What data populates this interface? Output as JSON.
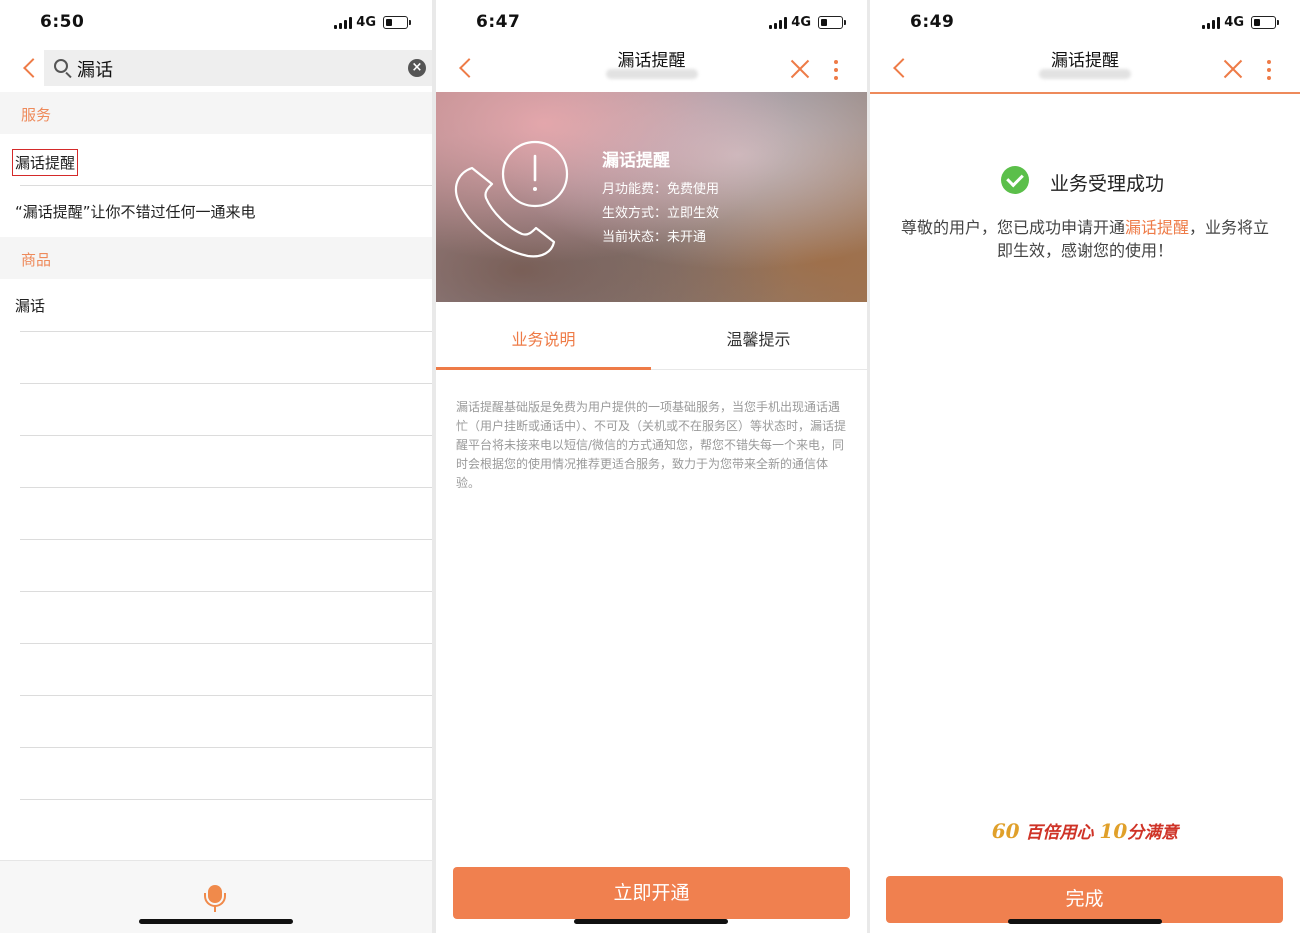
{
  "panel1": {
    "status": {
      "time": "6:50",
      "network": "4G"
    },
    "search": {
      "query": "漏话"
    },
    "sections": [
      {
        "title": "服务",
        "items": [
          "漏话提醒",
          "“漏话提醒”让你不错过任何一通来电"
        ]
      },
      {
        "title": "商品",
        "items": [
          "漏话"
        ]
      }
    ]
  },
  "panel2": {
    "status": {
      "time": "6:47",
      "network": "4G"
    },
    "header": {
      "title": "漏话提醒"
    },
    "banner": {
      "title": "漏话提醒",
      "lines": [
        "月功能费：免费使用",
        "生效方式：立即生效",
        "当前状态：未开通"
      ]
    },
    "tabs": [
      "业务说明",
      "温馨提示"
    ],
    "description": "漏话提醒基础版是免费为用户提供的一项基础服务，当您手机出现通话遇忙（用户挂断或通话中）、不可及（关机或不在服务区）等状态时，漏话提醒平台将未接来电以短信/微信的方式通知您，帮您不错失每一个来电，同时会根据您的使用情况推荐更适合服务，致力于为您带来全新的通信体验。",
    "button": "立即开通"
  },
  "panel3": {
    "status": {
      "time": "6:49",
      "network": "4G"
    },
    "header": {
      "title": "漏话提醒"
    },
    "success_title": "业务受理成功",
    "message_before": "尊敬的用户，您已成功申请开通",
    "message_highlight": "漏话提醒",
    "message_after": "，业务将立即生效，感谢您的使用！",
    "slogan_mark": "60",
    "slogan_text1": "百倍用心",
    "slogan_num": "10",
    "slogan_text2": "分满意",
    "button": "完成"
  },
  "colors": {
    "accent": "#ee7b47",
    "success": "#5bbf4a",
    "highlight_box": "#d42a2a"
  }
}
